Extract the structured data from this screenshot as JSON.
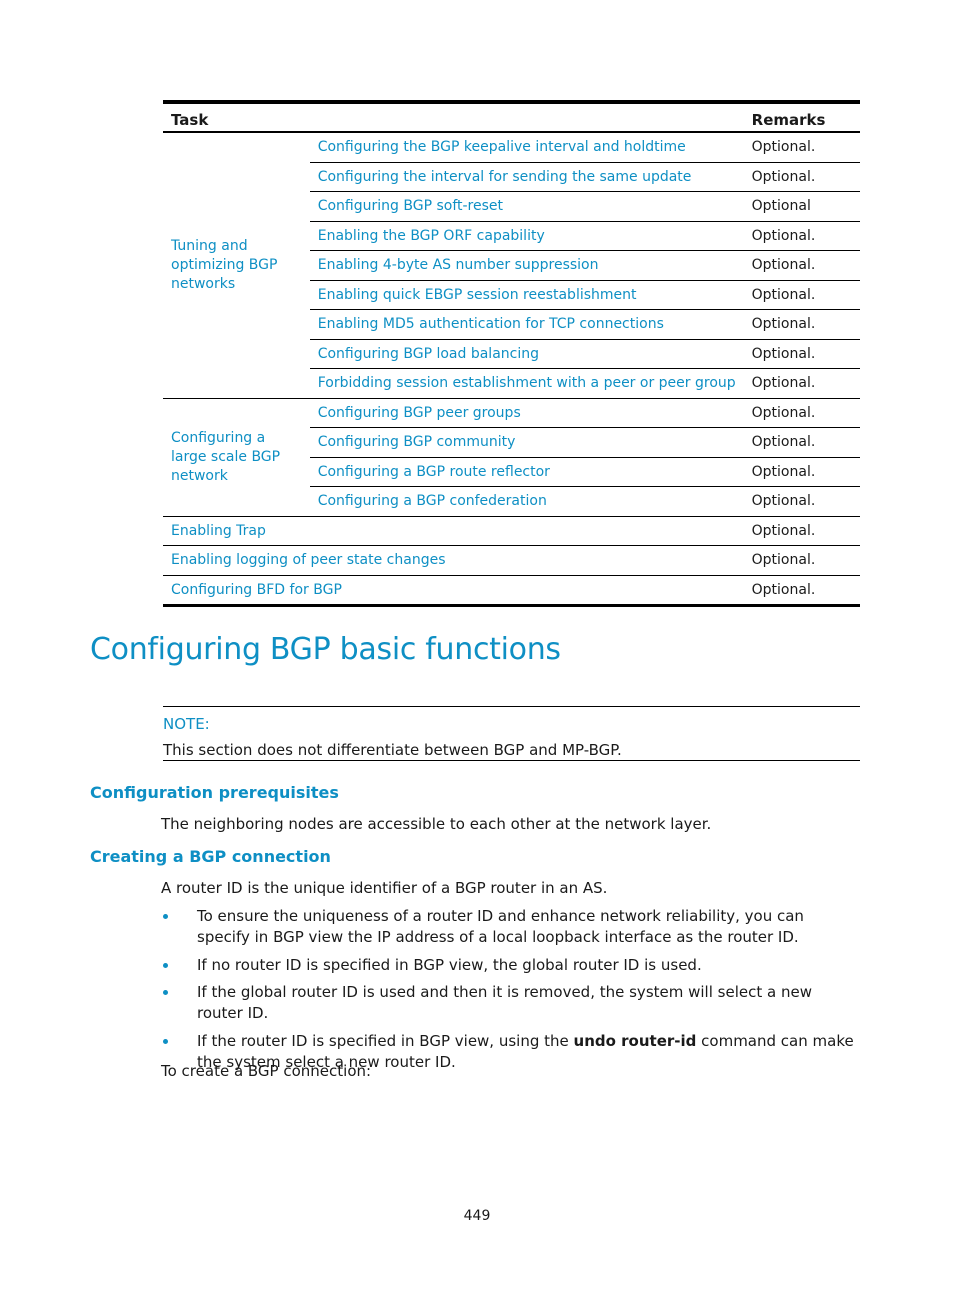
{
  "table": {
    "headers": {
      "task": "Task",
      "remarks": "Remarks"
    },
    "groups": [
      {
        "label": "Tuning and optimizing BGP networks",
        "rows": [
          {
            "task": "Configuring the BGP keepalive interval and holdtime",
            "remark": "Optional."
          },
          {
            "task": "Configuring the interval for sending the same update",
            "remark": "Optional."
          },
          {
            "task": "Configuring BGP soft-reset",
            "remark": "Optional"
          },
          {
            "task": "Enabling the BGP ORF capability",
            "remark": "Optional."
          },
          {
            "task": "Enabling 4-byte AS number suppression",
            "remark": "Optional."
          },
          {
            "task": "Enabling quick EBGP session reestablishment",
            "remark": "Optional."
          },
          {
            "task": "Enabling MD5 authentication for TCP connections",
            "remark": "Optional."
          },
          {
            "task": "Configuring BGP load balancing",
            "remark": "Optional."
          },
          {
            "task": "Forbidding session establishment with a peer or peer group",
            "remark": "Optional."
          }
        ]
      },
      {
        "label": "Configuring a large scale BGP network",
        "rows": [
          {
            "task": "Configuring BGP peer groups",
            "remark": "Optional."
          },
          {
            "task": "Configuring BGP community",
            "remark": "Optional."
          },
          {
            "task": "Configuring a BGP route reflector",
            "remark": "Optional."
          },
          {
            "task": "Configuring a BGP confederation",
            "remark": "Optional."
          }
        ]
      }
    ],
    "single_rows": [
      {
        "task": "Enabling Trap",
        "remark": "Optional."
      },
      {
        "task": "Enabling logging of peer state changes",
        "remark": "Optional."
      },
      {
        "task": "Configuring BFD for BGP",
        "remark": "Optional."
      }
    ]
  },
  "section": {
    "title": "Configuring BGP basic functions",
    "note_label": "NOTE:",
    "note_text": "This section does not differentiate between BGP and MP-BGP."
  },
  "prereq": {
    "heading": "Configuration prerequisites",
    "text": "The neighboring nodes are accessible to each other at the network layer."
  },
  "creating": {
    "heading": "Creating a BGP connection",
    "intro": "A router ID is the unique identifier of a BGP router in an AS.",
    "bullets": [
      {
        "text": "To ensure the uniqueness of a router ID and enhance network reliability, you can specify in BGP view the IP address of a local loopback interface as the router ID."
      },
      {
        "text": "If no router ID is specified in BGP view, the global router ID is used."
      },
      {
        "text": "If the global router ID is used and then it is removed, the system will select a new router ID."
      },
      {
        "pre": "If the router ID is specified in BGP view, using the ",
        "bold": "undo router-id",
        "post": " command can make the system select a new router ID."
      }
    ],
    "outro": "To create a BGP connection:"
  },
  "page_number": "449"
}
